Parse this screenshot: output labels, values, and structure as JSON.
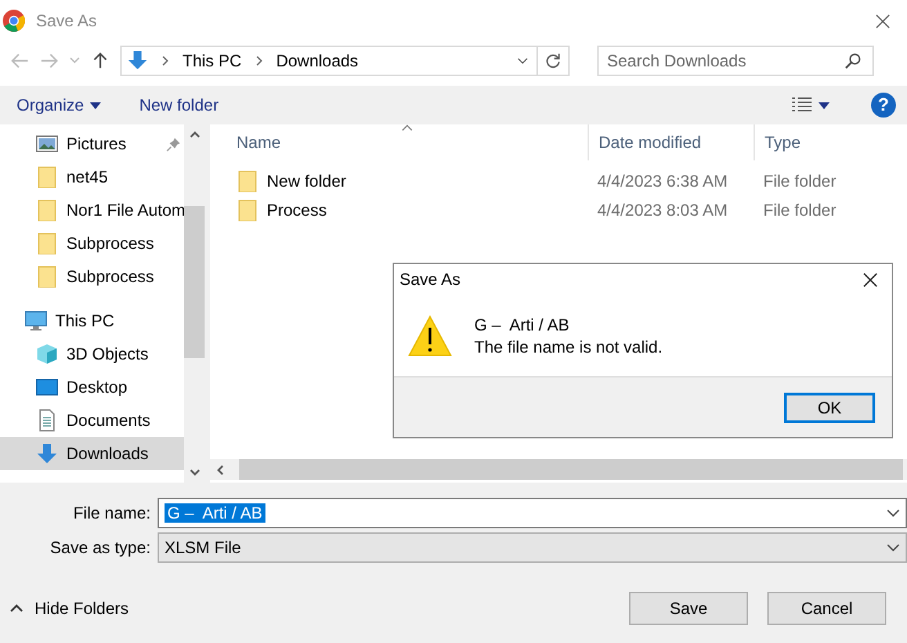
{
  "window": {
    "title": "Save As"
  },
  "address_bar": {
    "path": [
      "This PC",
      "Downloads"
    ]
  },
  "search": {
    "placeholder": "Search Downloads"
  },
  "toolbar": {
    "buttons": [
      "Organize",
      "New folder"
    ],
    "help": "?"
  },
  "sidebar": {
    "quick_access": [
      {
        "label": "Pictures",
        "kind": "pictures",
        "pinned": true,
        "selected": false
      },
      {
        "label": "net45",
        "kind": "folder",
        "pinned": false,
        "selected": false
      },
      {
        "label": "Nor1 File Autom",
        "kind": "folder",
        "pinned": false,
        "selected": false
      },
      {
        "label": "Subprocess",
        "kind": "folder",
        "pinned": false,
        "selected": false
      },
      {
        "label": "Subprocess",
        "kind": "folder",
        "pinned": false,
        "selected": false
      }
    ],
    "this_pc": {
      "label": "This PC",
      "children": [
        {
          "label": "3D Objects",
          "kind": "cube",
          "selected": false
        },
        {
          "label": "Desktop",
          "kind": "desktop",
          "selected": false
        },
        {
          "label": "Documents",
          "kind": "documents",
          "selected": false
        },
        {
          "label": "Downloads",
          "kind": "downloads",
          "selected": true
        }
      ]
    }
  },
  "file_list": {
    "columns": [
      "Name",
      "Date modified",
      "Type"
    ],
    "rows": [
      {
        "name": "New folder",
        "date_modified": "4/4/2023 6:38 AM",
        "type": "File folder"
      },
      {
        "name": "Process",
        "date_modified": "4/4/2023 8:03 AM",
        "type": "File folder"
      }
    ]
  },
  "file_name": {
    "label": "File name:",
    "value": "G –  Arti / AB"
  },
  "save_as_type": {
    "label": "Save as type:",
    "value": "XLSM File"
  },
  "hide_folders": "Hide Folders",
  "buttons": [
    "Save",
    "Cancel"
  ],
  "message_box": {
    "title": "Save As",
    "lines": [
      "G –  Arti / AB",
      "The file name is not valid."
    ],
    "button": "OK"
  }
}
